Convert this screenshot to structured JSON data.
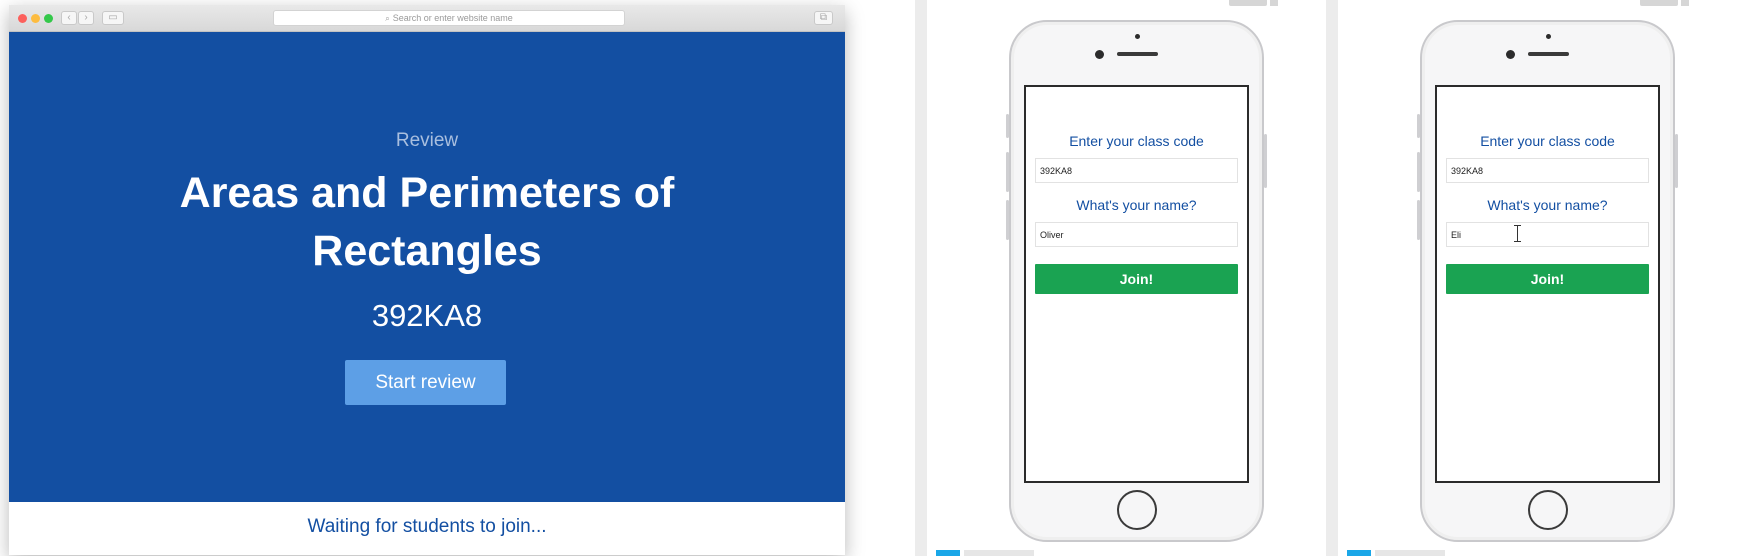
{
  "browser": {
    "address_placeholder": "Search or enter website name"
  },
  "review": {
    "label": "Review",
    "title": "Areas and Perimeters of Rectangles",
    "code": "392KA8",
    "start_button": "Start review",
    "waiting_text": "Waiting for students to join..."
  },
  "phones": [
    {
      "class_code_prompt": "Enter your class code",
      "class_code_value": "392KA8",
      "name_prompt": "What's your name?",
      "name_value": "Oliver",
      "join_button": "Join!"
    },
    {
      "class_code_prompt": "Enter your class code",
      "class_code_value": "392KA8",
      "name_prompt": "What's your name?",
      "name_value": "Eli",
      "join_button": "Join!"
    }
  ],
  "colors": {
    "brand_blue": "#134fa2",
    "start_button": "#5d9fe6",
    "join_green": "#1aa352"
  },
  "icons": {
    "search": "search-icon",
    "back": "chevron-left-icon",
    "forward": "chevron-right-icon",
    "sidebar": "sidebar-icon",
    "tabs": "tabs-icon",
    "text_cursor": "text-cursor-icon"
  }
}
